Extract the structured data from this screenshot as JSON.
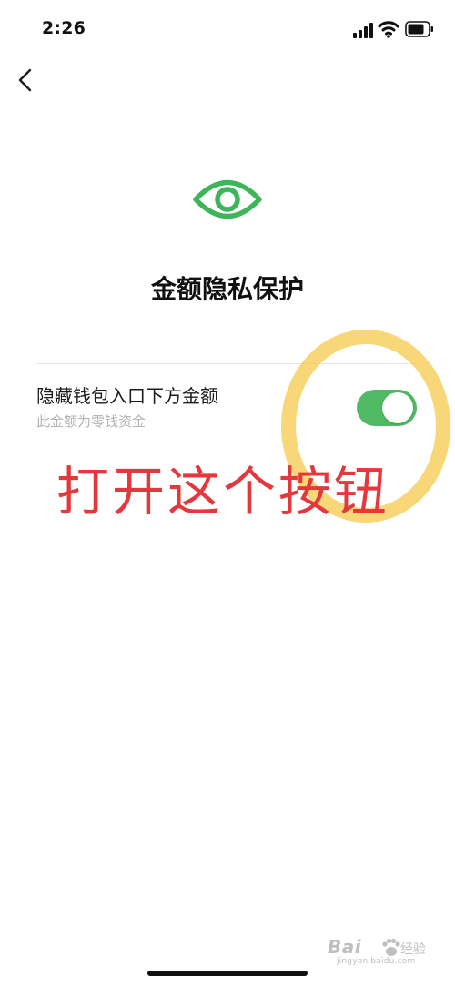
{
  "status_bar": {
    "time": "2:26",
    "icons": [
      "signal-icon",
      "wifi-icon",
      "battery-icon"
    ]
  },
  "nav": {
    "back_icon": "back-chevron-icon"
  },
  "header": {
    "icon": "eye-icon",
    "title": "金额隐私保护"
  },
  "setting": {
    "label": "隐藏钱包入口下方金额",
    "description": "此金额为零钱资金",
    "toggle_on": true
  },
  "annotation": {
    "text": "打开这个按钮"
  },
  "watermark": {
    "brand": "Bai",
    "brand_cn": "经验",
    "url": "jingyan.baidu.com"
  },
  "colors": {
    "accent_green": "#4fba63",
    "icon_green": "#3fb55b",
    "annotation_red": "#e4383d",
    "highlight_yellow": "#f5c844"
  }
}
